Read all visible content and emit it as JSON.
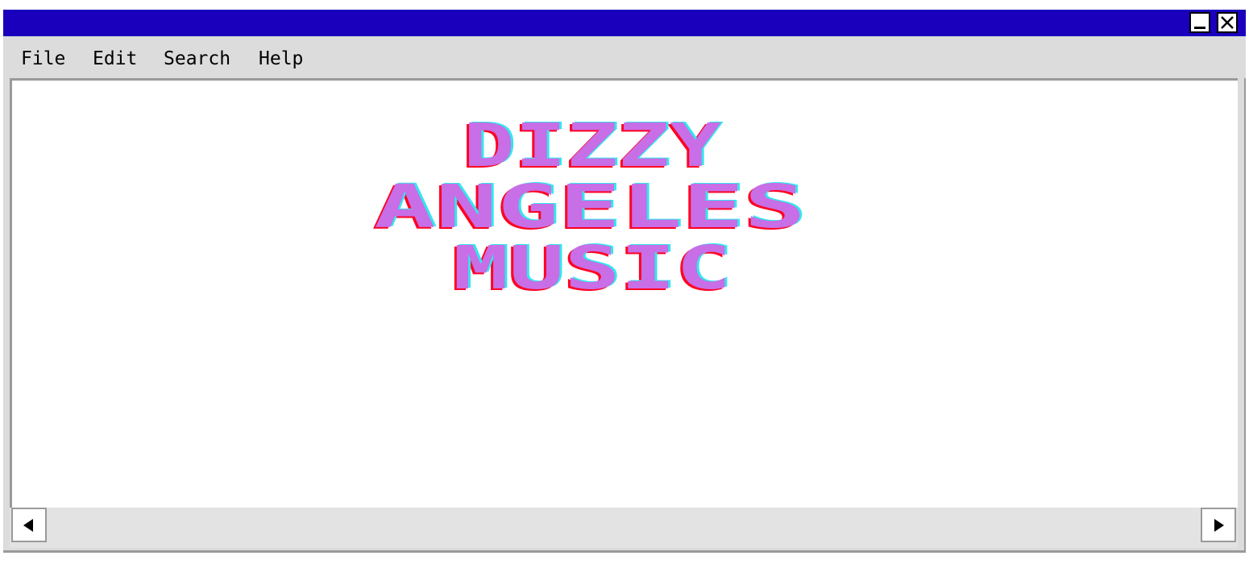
{
  "window": {
    "title": "",
    "minimize_icon": "minimize-icon",
    "close_icon": "close-icon",
    "titlebar_color": "#1a00bd"
  },
  "menu": {
    "items": [
      {
        "label": "File"
      },
      {
        "label": "Edit"
      },
      {
        "label": "Search"
      },
      {
        "label": "Help"
      }
    ]
  },
  "logo": {
    "lines": [
      "DIZZY",
      "ANGELES",
      "MUSIC"
    ],
    "fill_color": "#c86ee6",
    "shadow_left_color": "#ff0022",
    "shadow_right_color": "#33e6ee"
  },
  "scrollbar": {
    "left_icon": "arrow-left-icon",
    "right_icon": "arrow-right-icon"
  }
}
